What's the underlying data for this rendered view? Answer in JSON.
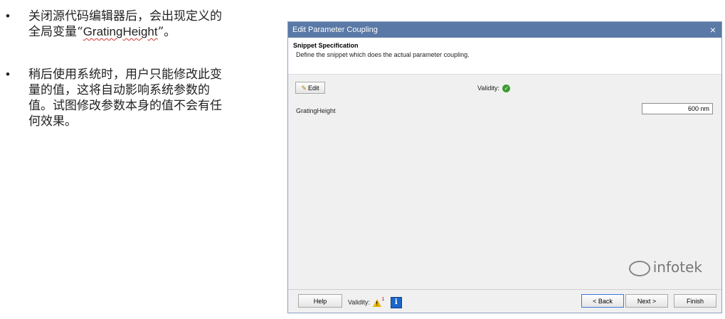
{
  "notes": {
    "bullets": [
      {
        "marker": "•",
        "text_before": "关闭源代码编辑器后，会出现定义的全局变量“",
        "code": "GratingHeight",
        "text_after": "”。"
      },
      {
        "marker": "•",
        "text": "稍后使用系统时，用户只能修改此变量的值，这将自动影响系统参数的值。试图修改参数本身的值不会有任何效果。"
      }
    ]
  },
  "dialog": {
    "title": "Edit Parameter Coupling",
    "close_glyph": "×",
    "header_title": "Snippet Specification",
    "header_desc": "Define the snippet which does the actual parameter coupling.",
    "edit_label": "Edit",
    "validity_label": "Validity:",
    "parameter": {
      "name": "GratingHeight",
      "value": "600 nm"
    },
    "footer": {
      "help_label": "Help",
      "validity_label": "Validity:",
      "warning_count": "1",
      "back_label": "< Back",
      "next_label": "Next >",
      "finish_label": "Finish"
    }
  },
  "watermark": "infotek",
  "icons": {
    "edit": "pencil-icon",
    "valid": "check-circle-icon",
    "warning": "warning-triangle-icon",
    "info": "info-icon",
    "close": "close-icon"
  },
  "colors": {
    "titlebar": "#5a79a6",
    "valid": "#3b9a2e",
    "warning": "#e9b600",
    "info": "#1b66c7"
  }
}
